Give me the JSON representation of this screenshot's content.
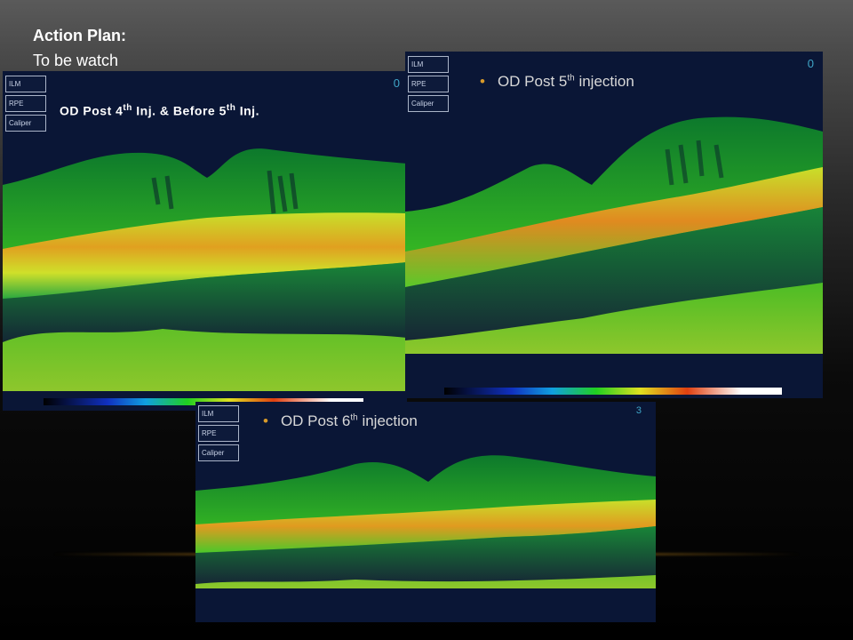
{
  "action_plan": {
    "title": "Action Plan:",
    "subtitle": "To be watch"
  },
  "buttons": [
    "ILM",
    "RPE",
    "Caliper"
  ],
  "panel1": {
    "label_pre": "OD Post 4",
    "label_sup1": "th",
    "label_mid": " Inj. & Before 5",
    "label_sup2": "th",
    "label_post": "  Inj.",
    "scale_num": "0"
  },
  "panel2": {
    "label_pre": "OD Post 5",
    "label_sup": "th",
    "label_post": "  injection",
    "scale_num": "0"
  },
  "panel3": {
    "label_pre": "OD Post 6",
    "label_sup": "th",
    "label_post": "  injection",
    "scale_num": "3"
  },
  "colors": {
    "bullet": "#d89a2a",
    "scale_num": "#3fa6c8"
  }
}
